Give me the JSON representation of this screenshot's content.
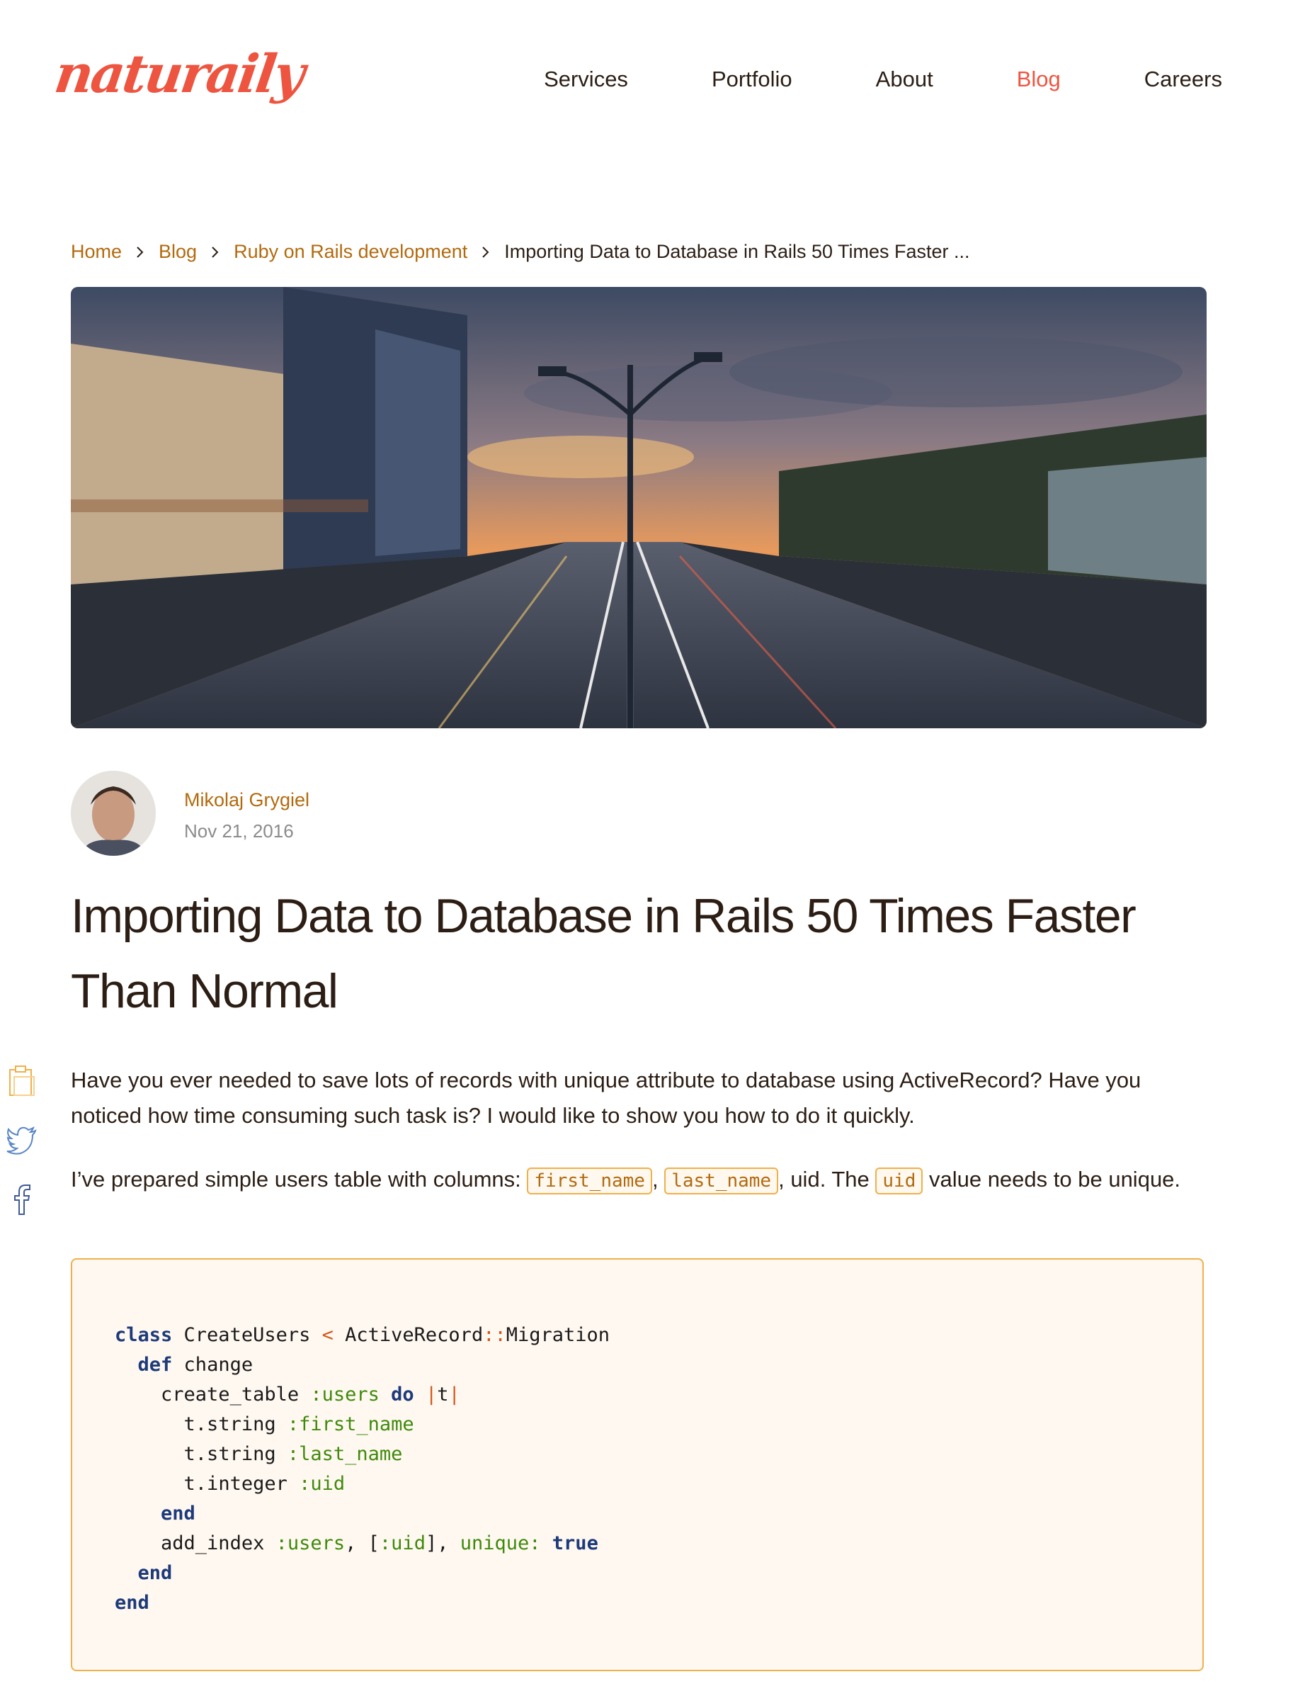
{
  "header": {
    "logo_text": "naturaily",
    "nav": [
      "Services",
      "Portfolio",
      "About",
      "Blog",
      "Careers"
    ],
    "active_nav": "Blog"
  },
  "breadcrumb": {
    "items": [
      "Home",
      "Blog",
      "Ruby on Rails development"
    ],
    "current": "Importing Data to Database in Rails 50 Times Faster ..."
  },
  "author": {
    "name": "Mikolaj Grygiel",
    "date": "Nov 21, 2016"
  },
  "article": {
    "title": "Importing Data to Database in Rails 50 Times Faster Than Normal",
    "intro": "Have you ever needed to save lots of records with unique attribute to database using ActiveRecord? Have you noticed how time consuming such task is? I would like to show you how to do it quickly.",
    "p2_prefix": "I’ve prepared simple users table with columns: ",
    "code_first_name": "first_name",
    "comma": ",",
    "code_last_name": "last_name",
    "p2_middle": ", uid. The ",
    "code_uid": "uid",
    "p2_suffix": " value needs to be unique."
  },
  "share": [
    "clipboard-icon",
    "twitter-icon",
    "facebook-icon"
  ],
  "code": {
    "l1_kw": "class",
    "l1_name": " CreateUsers ",
    "l1_op": "<",
    "l1_base1": " ActiveRecord",
    "l1_sep": "::",
    "l1_base2": "Migration",
    "l2_kw": "def",
    "l2_name": " change",
    "l3_call": "create_table ",
    "l3_sym": ":users",
    "l3_do": "do",
    "l3_pipe1": "|",
    "l3_var": "t",
    "l3_pipe2": "|",
    "l4_call": "t.string ",
    "l4_sym": ":first_name",
    "l5_call": "t.string ",
    "l5_sym": ":last_name",
    "l6_call": "t.integer ",
    "l6_sym": ":uid",
    "l7_end": "end",
    "l8_call": "add_index ",
    "l8_sym1": ":users",
    "l8_mid1": ", [",
    "l8_sym2": ":uid",
    "l8_mid2": "], ",
    "l8_sym3": "unique:",
    "l8_true": "true",
    "l9_end": "end",
    "l10_end": "end"
  },
  "colors": {
    "brand": "#ee5540",
    "link": "#b36a0e",
    "code_border": "#f0b04a"
  }
}
